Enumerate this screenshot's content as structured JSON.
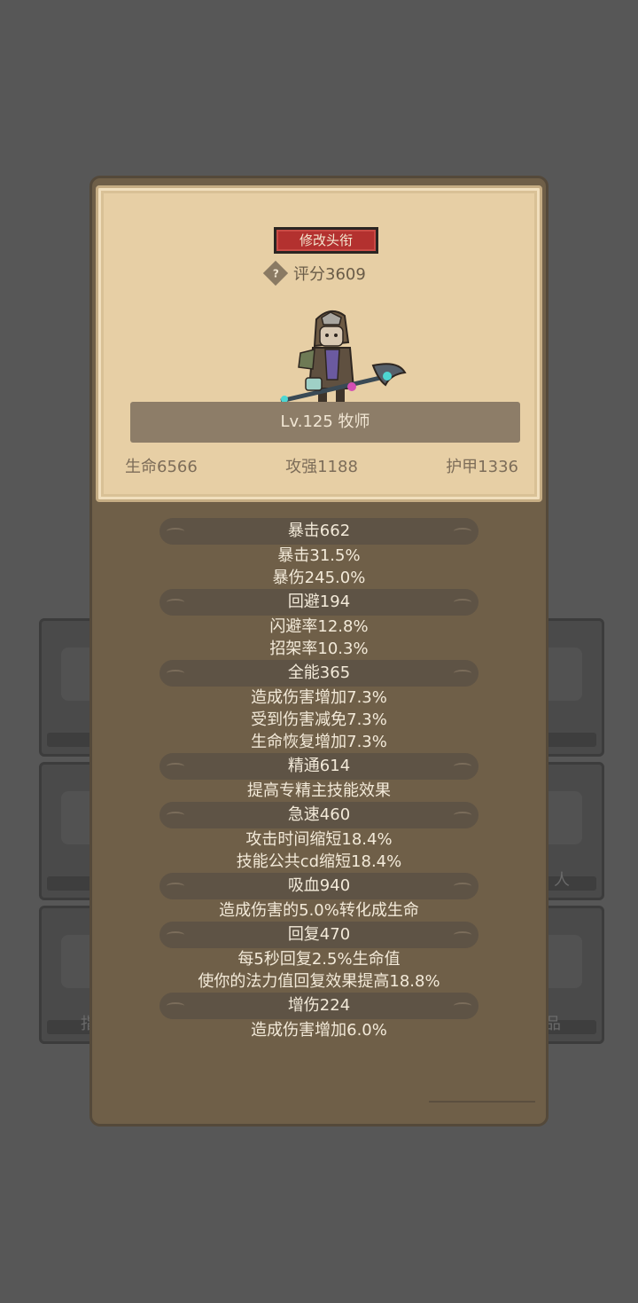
{
  "header": {
    "edit_title_button": "修改头衔",
    "help_icon": "?",
    "score": "评分3609"
  },
  "character": {
    "avatar_icon": "priest-avatar-icon",
    "level_class": "Lv.125 牧师"
  },
  "main_stats": {
    "hp": "生命6566",
    "attack": "攻强1188",
    "armor": "护甲1336"
  },
  "attributes": [
    {
      "head": "暴击662",
      "details": [
        "暴击31.5%",
        "暴伤245.0%"
      ]
    },
    {
      "head": "回避194",
      "details": [
        "闪避率12.8%",
        "招架率10.3%"
      ]
    },
    {
      "head": "全能365",
      "details": [
        "造成伤害增加7.3%",
        "受到伤害减免7.3%",
        "生命恢复增加7.3%"
      ]
    },
    {
      "head": "精通614",
      "details": [
        "提高专精主技能效果"
      ]
    },
    {
      "head": "急速460",
      "details": [
        "攻击时间缩短18.4%",
        "技能公共cd缩短18.4%"
      ]
    },
    {
      "head": "吸血940",
      "details": [
        "造成伤害的5.0%转化成生命"
      ]
    },
    {
      "head": "回复470",
      "details": [
        "每5秒回复2.5%生命值",
        "使你的法力值回复效果提高18.8%"
      ]
    },
    {
      "head": "增伤224",
      "details": [
        "造成伤害增加6.0%"
      ]
    }
  ],
  "background_cards": {
    "right_middle_label": "人",
    "right_bottom_label": "品",
    "left_bottom_label": "指"
  }
}
